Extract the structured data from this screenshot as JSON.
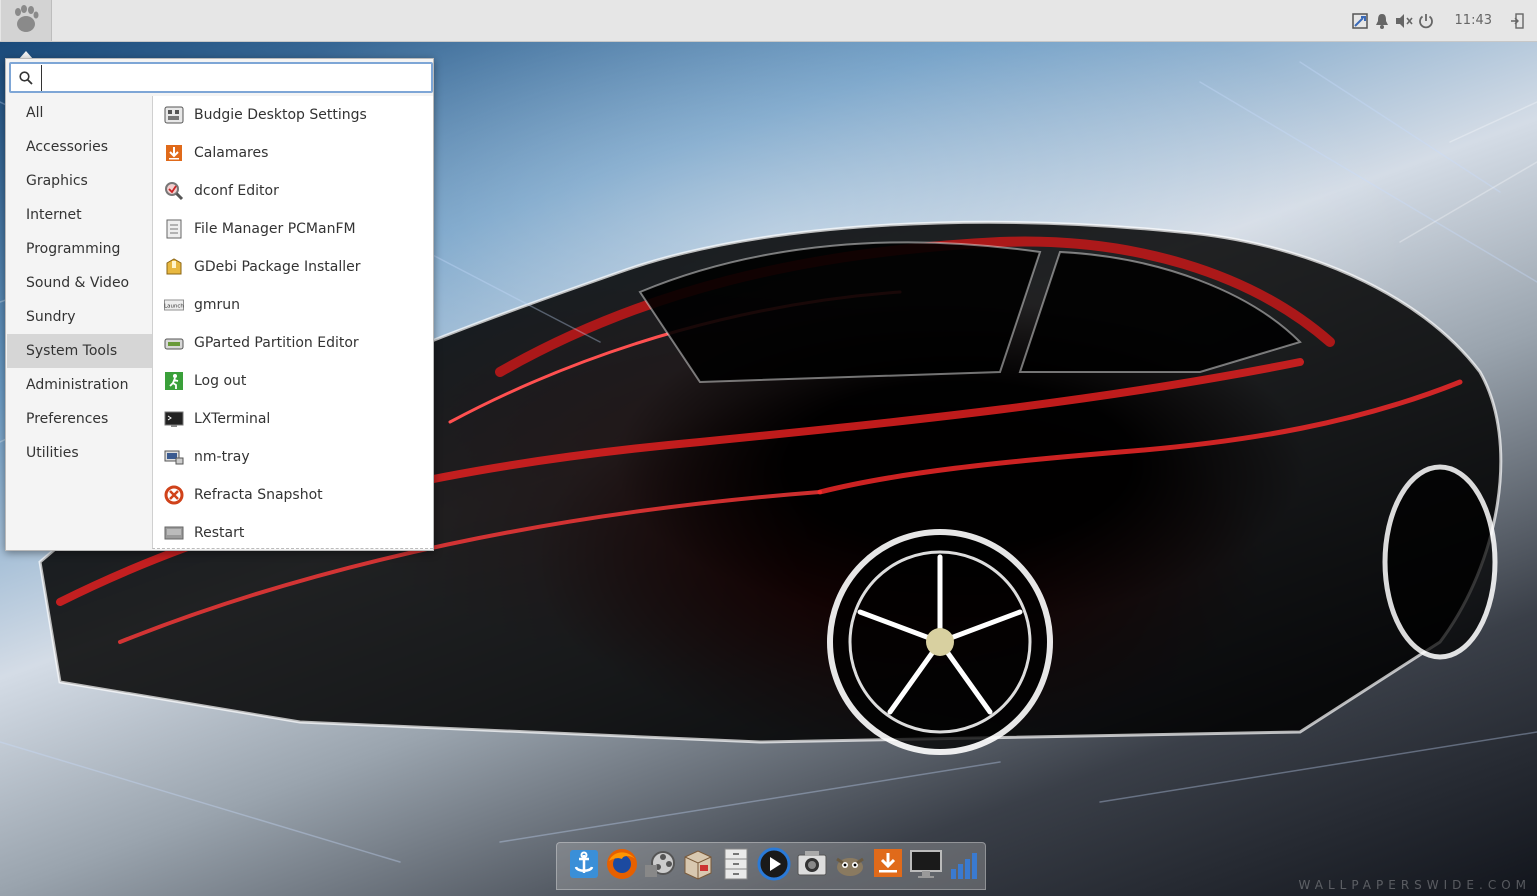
{
  "panel": {
    "clock": "11:43",
    "tray_icons": [
      "network-icon",
      "notification-bell-icon",
      "volume-muted-icon",
      "power-icon"
    ],
    "end_icon": "logout-arrow-icon"
  },
  "menu": {
    "search": {
      "value": "",
      "placeholder": ""
    },
    "categories": [
      {
        "label": "All"
      },
      {
        "label": "Accessories"
      },
      {
        "label": "Graphics"
      },
      {
        "label": "Internet"
      },
      {
        "label": "Programming"
      },
      {
        "label": "Sound & Video"
      },
      {
        "label": "Sundry"
      },
      {
        "label": "System Tools"
      },
      {
        "label": "Administration"
      },
      {
        "label": "Preferences"
      },
      {
        "label": "Utilities"
      }
    ],
    "active_category": "System Tools",
    "apps": [
      {
        "label": "Budgie Desktop Settings",
        "icon": "settings-panel-icon"
      },
      {
        "label": "Calamares",
        "icon": "installer-icon"
      },
      {
        "label": "dconf Editor",
        "icon": "dconf-magnifier-icon"
      },
      {
        "label": "File Manager PCManFM",
        "icon": "file-manager-icon"
      },
      {
        "label": "GDebi Package Installer",
        "icon": "package-icon"
      },
      {
        "label": "gmrun",
        "icon": "launch-icon"
      },
      {
        "label": "GParted Partition Editor",
        "icon": "disk-icon"
      },
      {
        "label": "Log out",
        "icon": "exit-icon"
      },
      {
        "label": "LXTerminal",
        "icon": "terminal-icon"
      },
      {
        "label": "nm-tray",
        "icon": "network-tray-icon"
      },
      {
        "label": "Refracta Snapshot",
        "icon": "snapshot-icon"
      },
      {
        "label": "Restart",
        "icon": "restart-icon"
      }
    ]
  },
  "dock": {
    "items": [
      "anchor-icon",
      "firefox-icon",
      "video-editor-icon",
      "package-box-icon",
      "file-cabinet-icon",
      "media-player-icon",
      "screenshot-icon",
      "gimp-icon",
      "download-installer-icon",
      "monitor-icon",
      "signal-bars-icon"
    ]
  },
  "wallpaper": {
    "watermark": "WALLPAPERSWIDE.COM"
  },
  "colors": {
    "panel": "#e6e6e6",
    "search_border": "#7ea6d6",
    "active_category": "#d6d6d6"
  }
}
